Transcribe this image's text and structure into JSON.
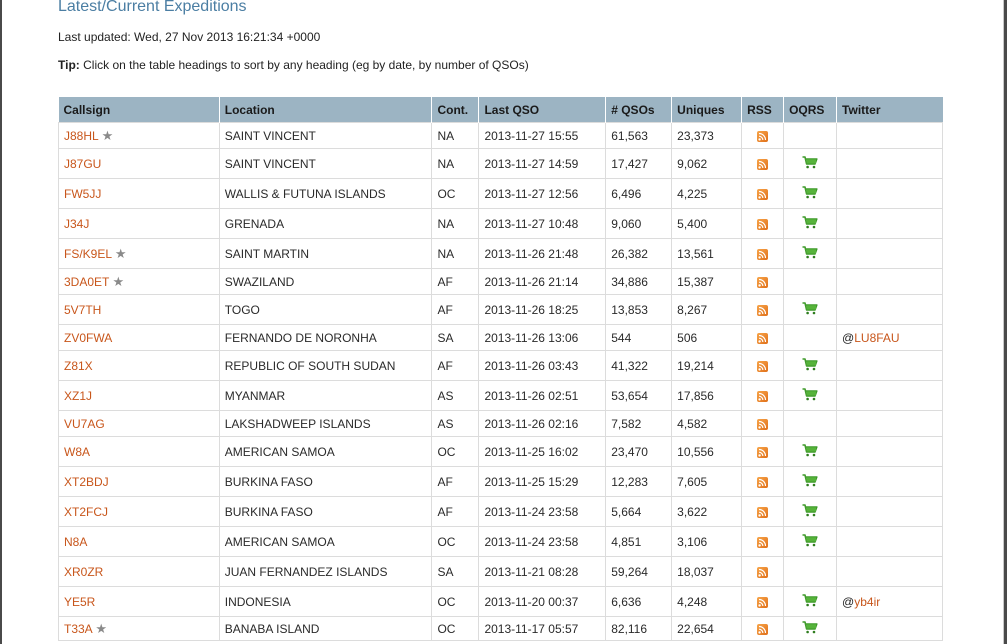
{
  "page": {
    "title": "Latest/Current Expeditions",
    "last_updated": "Last updated: Wed, 27 Nov 2013 16:21:34 +0000",
    "tip_label": "Tip:",
    "tip_text": " Click on the table headings to sort by any heading (eg by date, by number of QSOs)"
  },
  "colors": {
    "title": "#4b7ea3",
    "header_bg": "#9cb4c3",
    "callsign": "#c8561b",
    "rss": "#e0701a",
    "cart": "#3f9a2a"
  },
  "table": {
    "headers": {
      "callsign": "Callsign",
      "location": "Location",
      "cont": "Cont.",
      "last_qso": "Last QSO",
      "qsos": "# QSOs",
      "uniques": "Uniques",
      "rss": "RSS",
      "oqrs": "OQRS",
      "twitter": "Twitter"
    },
    "icons": {
      "rss": "rss-feed-icon",
      "oqrs": "shopping-cart-icon",
      "star": "star-icon"
    },
    "rows": [
      {
        "callsign": "J88HL",
        "star": true,
        "location": "SAINT VINCENT",
        "cont": "NA",
        "last_qso": "2013-11-27 15:55",
        "qsos": "61,563",
        "uniques": "23,373",
        "rss": true,
        "oqrs": false,
        "twitter": ""
      },
      {
        "callsign": "J87GU",
        "star": false,
        "location": "SAINT VINCENT",
        "cont": "NA",
        "last_qso": "2013-11-27 14:59",
        "qsos": "17,427",
        "uniques": "9,062",
        "rss": true,
        "oqrs": true,
        "twitter": ""
      },
      {
        "callsign": "FW5JJ",
        "star": false,
        "location": "WALLIS & FUTUNA ISLANDS",
        "cont": "OC",
        "last_qso": "2013-11-27 12:56",
        "qsos": "6,496",
        "uniques": "4,225",
        "rss": true,
        "oqrs": true,
        "twitter": ""
      },
      {
        "callsign": "J34J",
        "star": false,
        "location": "GRENADA",
        "cont": "NA",
        "last_qso": "2013-11-27 10:48",
        "qsos": "9,060",
        "uniques": "5,400",
        "rss": true,
        "oqrs": true,
        "twitter": ""
      },
      {
        "callsign": "FS/K9EL",
        "star": true,
        "location": "SAINT MARTIN",
        "cont": "NA",
        "last_qso": "2013-11-26 21:48",
        "qsos": "26,382",
        "uniques": "13,561",
        "rss": true,
        "oqrs": true,
        "twitter": ""
      },
      {
        "callsign": "3DA0ET",
        "star": true,
        "location": "SWAZILAND",
        "cont": "AF",
        "last_qso": "2013-11-26 21:14",
        "qsos": "34,886",
        "uniques": "15,387",
        "rss": true,
        "oqrs": false,
        "twitter": ""
      },
      {
        "callsign": "5V7TH",
        "star": false,
        "location": "TOGO",
        "cont": "AF",
        "last_qso": "2013-11-26 18:25",
        "qsos": "13,853",
        "uniques": "8,267",
        "rss": true,
        "oqrs": true,
        "twitter": ""
      },
      {
        "callsign": "ZV0FWA",
        "star": false,
        "location": "FERNANDO DE NORONHA",
        "cont": "SA",
        "last_qso": "2013-11-26 13:06",
        "qsos": "544",
        "uniques": "506",
        "rss": true,
        "oqrs": false,
        "twitter": "LU8FAU"
      },
      {
        "callsign": "Z81X",
        "star": false,
        "location": "REPUBLIC OF SOUTH SUDAN",
        "cont": "AF",
        "last_qso": "2013-11-26 03:43",
        "qsos": "41,322",
        "uniques": "19,214",
        "rss": true,
        "oqrs": true,
        "twitter": ""
      },
      {
        "callsign": "XZ1J",
        "star": false,
        "location": "MYANMAR",
        "cont": "AS",
        "last_qso": "2013-11-26 02:51",
        "qsos": "53,654",
        "uniques": "17,856",
        "rss": true,
        "oqrs": true,
        "twitter": ""
      },
      {
        "callsign": "VU7AG",
        "star": false,
        "location": "LAKSHADWEEP ISLANDS",
        "cont": "AS",
        "last_qso": "2013-11-26 02:16",
        "qsos": "7,582",
        "uniques": "4,582",
        "rss": true,
        "oqrs": false,
        "twitter": ""
      },
      {
        "callsign": "W8A",
        "star": false,
        "location": "AMERICAN SAMOA",
        "cont": "OC",
        "last_qso": "2013-11-25 16:02",
        "qsos": "23,470",
        "uniques": "10,556",
        "rss": true,
        "oqrs": true,
        "twitter": ""
      },
      {
        "callsign": "XT2BDJ",
        "star": false,
        "location": "BURKINA FASO",
        "cont": "AF",
        "last_qso": "2013-11-25 15:29",
        "qsos": "12,283",
        "uniques": "7,605",
        "rss": true,
        "oqrs": true,
        "twitter": ""
      },
      {
        "callsign": "XT2FCJ",
        "star": false,
        "location": "BURKINA FASO",
        "cont": "AF",
        "last_qso": "2013-11-24 23:58",
        "qsos": "5,664",
        "uniques": "3,622",
        "rss": true,
        "oqrs": true,
        "twitter": ""
      },
      {
        "callsign": "N8A",
        "star": false,
        "location": "AMERICAN SAMOA",
        "cont": "OC",
        "last_qso": "2013-11-24 23:58",
        "qsos": "4,851",
        "uniques": "3,106",
        "rss": true,
        "oqrs": true,
        "twitter": ""
      },
      {
        "callsign": "XR0ZR",
        "star": false,
        "location": "JUAN FERNANDEZ ISLANDS",
        "cont": "SA",
        "last_qso": "2013-11-21 08:28",
        "qsos": "59,264",
        "uniques": "18,037",
        "rss": true,
        "oqrs": false,
        "twitter": ""
      },
      {
        "callsign": "YE5R",
        "star": false,
        "location": "INDONESIA",
        "cont": "OC",
        "last_qso": "2013-11-20 00:37",
        "qsos": "6,636",
        "uniques": "4,248",
        "rss": true,
        "oqrs": true,
        "twitter": "yb4ir"
      },
      {
        "callsign": "T33A",
        "star": true,
        "location": "BANABA ISLAND",
        "cont": "OC",
        "last_qso": "2013-11-17 05:57",
        "qsos": "82,116",
        "uniques": "22,654",
        "rss": true,
        "oqrs": true,
        "twitter": ""
      }
    ]
  }
}
